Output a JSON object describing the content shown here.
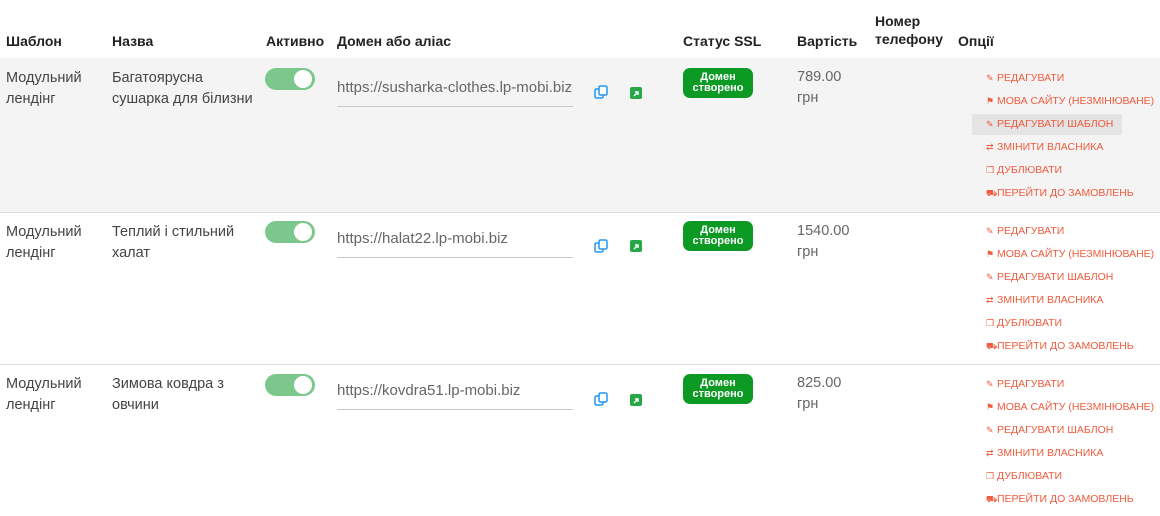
{
  "headers": {
    "template": "Шаблон",
    "name": "Назва",
    "active": "Активно",
    "domain": "Домен або аліас",
    "ssl": "Статус SSL",
    "price": "Вартість",
    "phone": "Номер телефону",
    "options": "Опції"
  },
  "option_icons": {
    "edit": "✎",
    "lang": "⚑",
    "edit_template": "✎",
    "change_owner": "⇄",
    "duplicate": "❐",
    "orders": "⛟"
  },
  "rows": [
    {
      "template": "Модульний лендінг",
      "name": "Багатоярусна сушарка для білизни",
      "active": true,
      "domain": "https://susharka-clothes.lp-mobi.biz",
      "ssl": "Домен створено",
      "price": "789.00 грн",
      "options": {
        "edit": "РЕДАГУВАТИ",
        "lang": "МОВА САЙТУ (НЕЗМІНЮВАНЕ)",
        "edit_template": "РЕДАГУВАТИ ШАБЛОН",
        "change_owner": "ЗМІНИТИ ВЛАСНИКА",
        "duplicate": "ДУБЛЮВАТИ",
        "orders": "ПЕРЕЙТИ ДО ЗАМОВЛЕНЬ"
      }
    },
    {
      "template": "Модульний лендінг",
      "name": "Теплий і стильний халат",
      "active": true,
      "domain": "https://halat22.lp-mobi.biz",
      "ssl": "Домен створено",
      "price": "1540.00 грн",
      "options": {
        "edit": "РЕДАГУВАТИ",
        "lang": "МОВА САЙТУ (НЕЗМІНЮВАНЕ)",
        "edit_template": "РЕДАГУВАТИ ШАБЛОН",
        "change_owner": "ЗМІНИТИ ВЛАСНИКА",
        "duplicate": "ДУБЛЮВАТИ",
        "orders": "ПЕРЕЙТИ ДО ЗАМОВЛЕНЬ"
      }
    },
    {
      "template": "Модульний лендінг",
      "name": "Зимова ковдра з овчини",
      "active": true,
      "domain": "https://kovdra51.lp-mobi.biz",
      "ssl": "Домен створено",
      "price": "825.00 грн",
      "options": {
        "edit": "РЕДАГУВАТИ",
        "lang": "МОВА САЙТУ (НЕЗМІНЮВАНЕ)",
        "edit_template": "РЕДАГУВАТИ ШАБЛОН",
        "change_owner": "ЗМІНИТИ ВЛАСНИКА",
        "duplicate": "ДУБЛЮВАТИ",
        "orders": "ПЕРЕЙТИ ДО ЗАМОВЛЕНЬ"
      }
    }
  ],
  "colors": {
    "toggle_on": "#7bc78c",
    "ssl_badge": "#0c9a24",
    "option_link": "#ef5b3c",
    "copy_icon": "#2196f3",
    "open_icon": "#27a745"
  }
}
